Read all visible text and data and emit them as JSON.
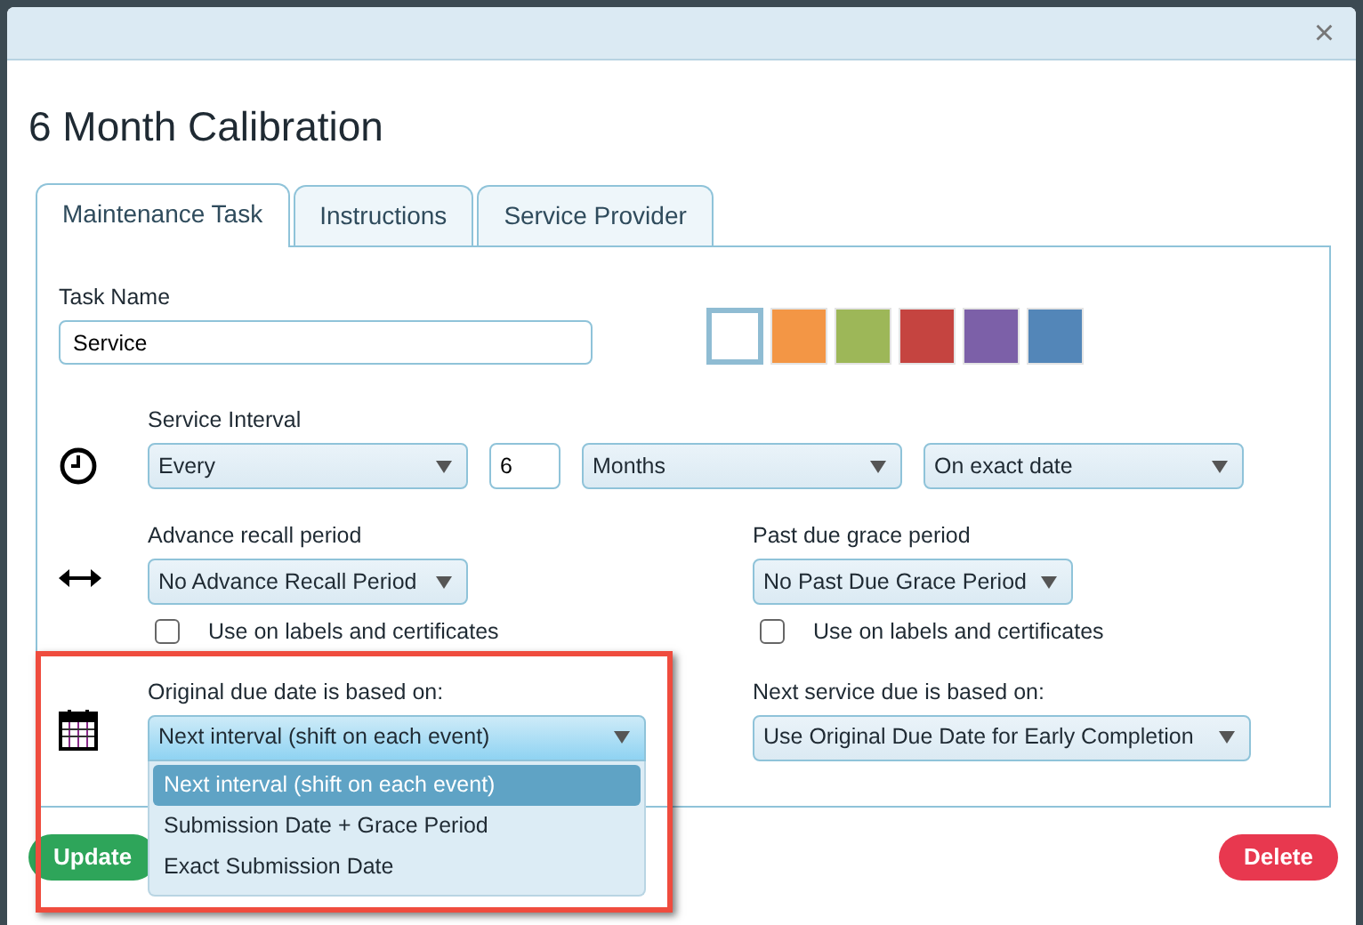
{
  "dialog": {
    "close": "×",
    "title": "6 Month Calibration"
  },
  "tabs": [
    {
      "label": "Maintenance Task",
      "selected": true
    },
    {
      "label": "Instructions",
      "selected": false
    },
    {
      "label": "Service Provider",
      "selected": false
    }
  ],
  "task_name": {
    "label": "Task Name",
    "value": "Service"
  },
  "colors": [
    {
      "color": "#ffffff",
      "selected": true
    },
    {
      "color": "#f39645",
      "selected": false
    },
    {
      "color": "#9db758",
      "selected": false
    },
    {
      "color": "#c54440",
      "selected": false
    },
    {
      "color": "#7c60a8",
      "selected": false
    },
    {
      "color": "#5386b8",
      "selected": false
    }
  ],
  "service_interval": {
    "label": "Service Interval",
    "repeat": "Every",
    "count": "6",
    "unit": "Months",
    "timing": "On exact date"
  },
  "advance_recall": {
    "label": "Advance recall period",
    "value": "No Advance Recall Period",
    "checkbox": {
      "label": "Use on labels and certificates",
      "checked": false
    }
  },
  "past_due": {
    "label": "Past due grace period",
    "value": "No Past Due Grace Period",
    "checkbox": {
      "label": "Use on labels and certificates",
      "checked": false
    }
  },
  "original_due": {
    "label": "Original due date is based on:",
    "value": "Next interval (shift on each event)",
    "expanded": true,
    "options": [
      {
        "label": "Next interval (shift on each event)",
        "selected": true
      },
      {
        "label": "Submission Date + Grace Period",
        "selected": false
      },
      {
        "label": "Exact Submission Date",
        "selected": false
      }
    ]
  },
  "next_service": {
    "label": "Next service due is based on:",
    "value": "Use Original Due Date for Early Completion"
  },
  "buttons": [
    {
      "label": "Update",
      "kind": "primary"
    },
    {
      "label": "Delete",
      "kind": "danger"
    }
  ]
}
